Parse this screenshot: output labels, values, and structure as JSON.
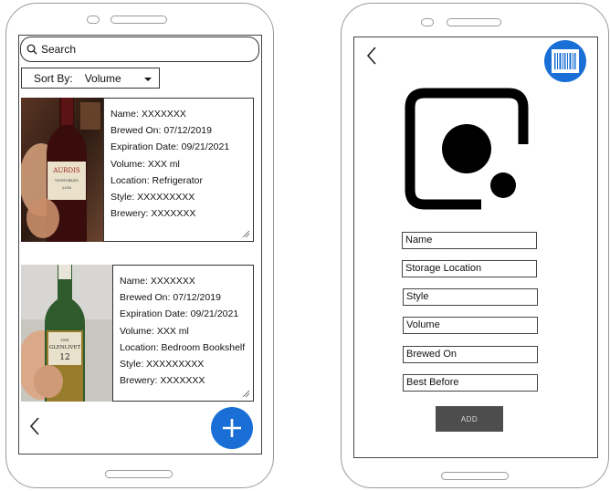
{
  "list_screen": {
    "search_placeholder": "Search",
    "sort_label": "Sort By:",
    "sort_value": "Volume",
    "items": [
      {
        "name": "Name: XXXXXXX",
        "brewed_on": "Brewed On: 07/12/2019",
        "expiration": "Expiration Date: 09/21/2021",
        "volume": "Volume: XXX ml",
        "location": "Location: Refrigerator",
        "style": "Style: XXXXXXXXX",
        "brewery": "Brewery: XXXXXXX",
        "photo": "wine-bottle-photo"
      },
      {
        "name": "Name: XXXXXXX",
        "brewed_on": "Brewed On: 07/12/2019",
        "expiration": "Expiration Date: 09/21/2021",
        "volume": "Volume: XXX ml",
        "location": "Location: Bedroom Bookshelf",
        "style": "Style: XXXXXXXXX",
        "brewery": "Brewery: XXXXXXX",
        "photo": "whisky-bottle-photo"
      }
    ],
    "back_icon": "chevron-left-icon",
    "add_icon": "plus-icon",
    "accent_color": "#1a6fd6"
  },
  "add_screen": {
    "back_icon": "chevron-left-icon",
    "barcode_icon": "barcode-icon",
    "camera_icon": "camera-capture-icon",
    "fields": [
      "Name",
      "Storage Location",
      "Style",
      "Volume",
      "Brewed On",
      "Best Before"
    ],
    "add_button_label": "ADD"
  }
}
